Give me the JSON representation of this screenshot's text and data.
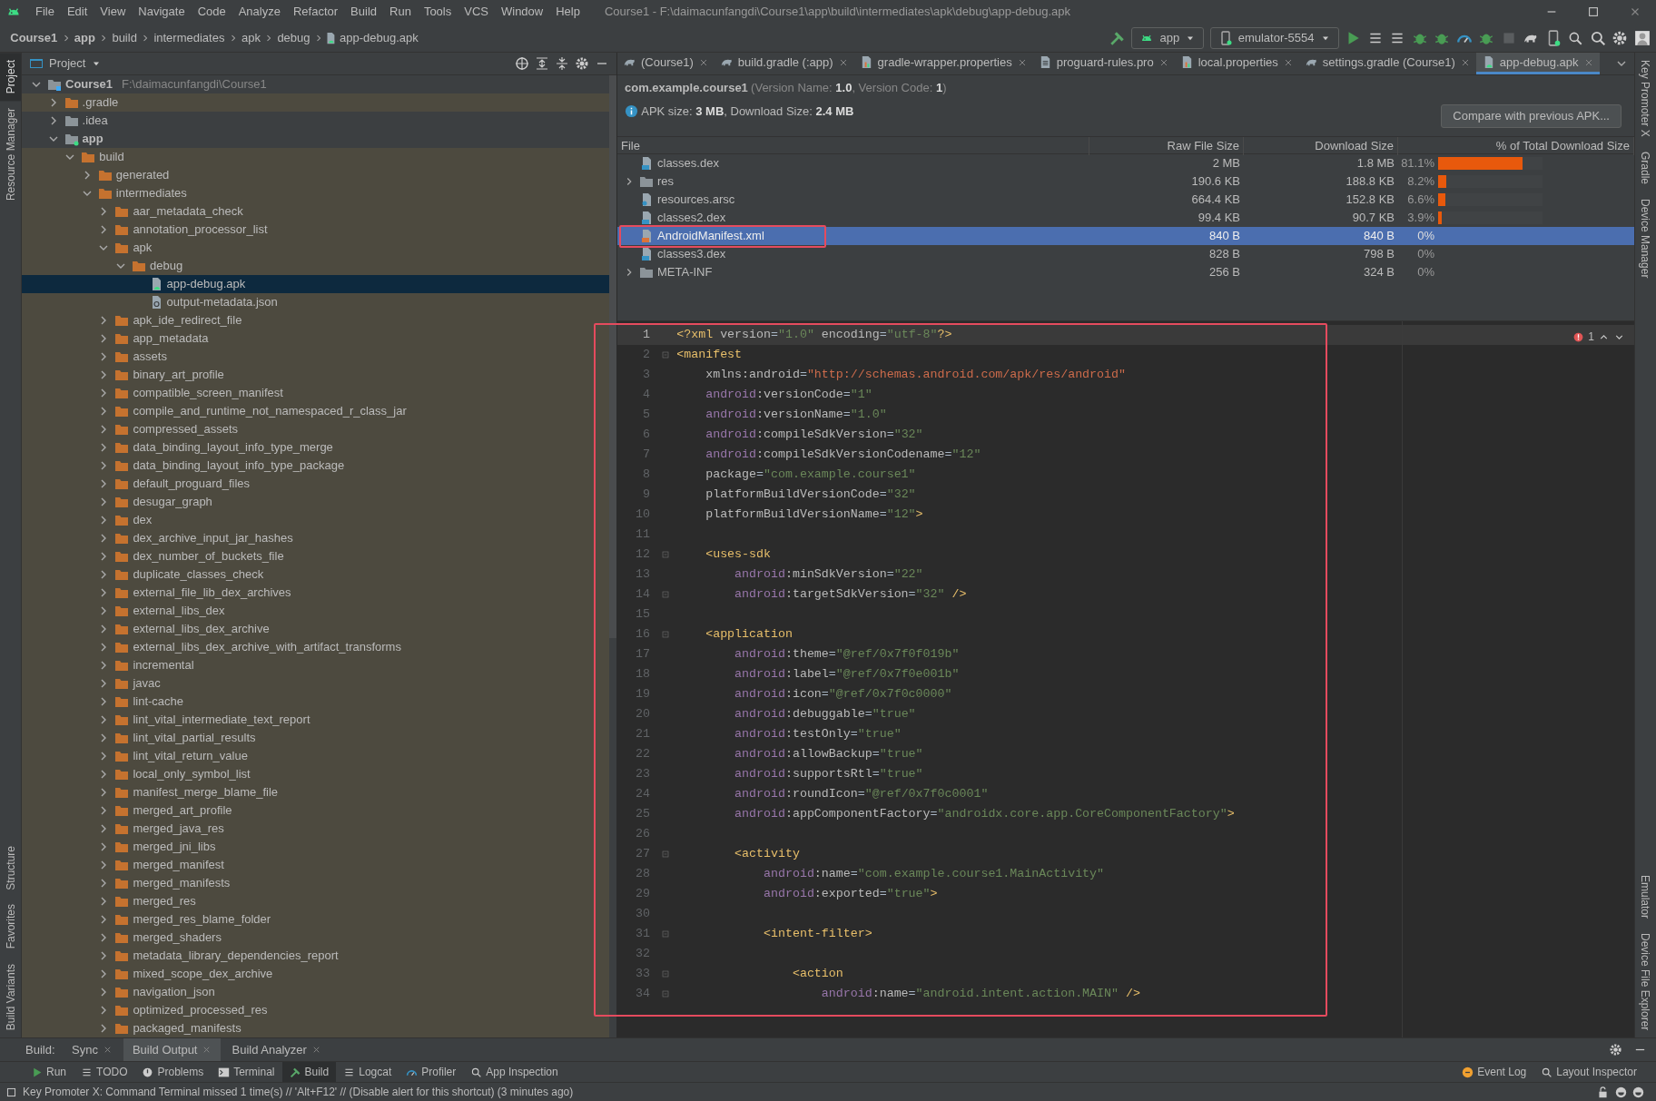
{
  "window": {
    "title": "Course1 - F:\\daimacunfangdi\\Course1\\app\\build\\intermediates\\apk\\debug\\app-debug.apk"
  },
  "menu": [
    "File",
    "Edit",
    "View",
    "Navigate",
    "Code",
    "Analyze",
    "Refactor",
    "Build",
    "Run",
    "Tools",
    "VCS",
    "Window",
    "Help"
  ],
  "breadcrumbs": [
    {
      "label": "Course1",
      "kind": "module"
    },
    {
      "label": "app",
      "kind": "module"
    },
    {
      "label": "build",
      "kind": "dir"
    },
    {
      "label": "intermediates",
      "kind": "dir"
    },
    {
      "label": "apk",
      "kind": "dir"
    },
    {
      "label": "debug",
      "kind": "dir"
    },
    {
      "label": "app-debug.apk",
      "kind": "file"
    }
  ],
  "run_config": "app",
  "device": "emulator-5554",
  "left_strip": {
    "top": [
      {
        "label": "Project",
        "selected": true
      },
      {
        "label": "Resource Manager",
        "selected": false
      }
    ],
    "bottom": [
      {
        "label": "Structure",
        "selected": false
      },
      {
        "label": "Favorites",
        "selected": false
      },
      {
        "label": "Build Variants",
        "selected": false
      }
    ]
  },
  "right_strip": {
    "top": [
      {
        "label": "Key Promoter X"
      },
      {
        "label": "Gradle"
      },
      {
        "label": "Device Manager"
      }
    ],
    "bottom": [
      {
        "label": "Emulator"
      },
      {
        "label": "Device File Explorer"
      }
    ]
  },
  "project_panel": {
    "title": "Project",
    "tree": [
      {
        "label": "Course1",
        "path": "F:\\daimacunfangdi\\Course1",
        "kind": "project",
        "expanded": true,
        "selected": false,
        "excluded": false,
        "children": [
          {
            "label": ".gradle",
            "kind": "folder",
            "expanded": false,
            "selected": false,
            "excluded": true
          },
          {
            "label": ".idea",
            "kind": "folder",
            "expanded": false,
            "selected": false,
            "excluded": false
          },
          {
            "label": "app",
            "kind": "module",
            "expanded": true,
            "selected": false,
            "excluded": false,
            "children": [
              {
                "label": "build",
                "kind": "folder",
                "expanded": true,
                "selected": false,
                "excluded": true,
                "children": [
                  {
                    "label": "generated",
                    "kind": "folder",
                    "expanded": false,
                    "selected": false,
                    "excluded": true
                  },
                  {
                    "label": "intermediates",
                    "kind": "folder",
                    "expanded": true,
                    "selected": false,
                    "excluded": true,
                    "children": [
                      {
                        "label": "aar_metadata_check",
                        "kind": "folder",
                        "expanded": false,
                        "selected": false,
                        "excluded": true
                      },
                      {
                        "label": "annotation_processor_list",
                        "kind": "folder",
                        "expanded": false,
                        "selected": false,
                        "excluded": true
                      },
                      {
                        "label": "apk",
                        "kind": "folder",
                        "expanded": true,
                        "selected": false,
                        "excluded": true,
                        "children": [
                          {
                            "label": "debug",
                            "kind": "folder",
                            "expanded": true,
                            "selected": false,
                            "excluded": true,
                            "children": [
                              {
                                "label": "app-debug.apk",
                                "kind": "apk",
                                "selected": true
                              },
                              {
                                "label": "output-metadata.json",
                                "kind": "json",
                                "selected": false,
                                "excluded": true
                              }
                            ]
                          }
                        ]
                      },
                      {
                        "label": "apk_ide_redirect_file",
                        "kind": "folder",
                        "expanded": false,
                        "selected": false,
                        "excluded": true
                      },
                      {
                        "label": "app_metadata",
                        "kind": "folder",
                        "expanded": false,
                        "selected": false,
                        "excluded": true
                      },
                      {
                        "label": "assets",
                        "kind": "folder",
                        "expanded": false,
                        "selected": false,
                        "excluded": true
                      },
                      {
                        "label": "binary_art_profile",
                        "kind": "folder",
                        "expanded": false,
                        "selected": false,
                        "excluded": true
                      },
                      {
                        "label": "compatible_screen_manifest",
                        "kind": "folder",
                        "expanded": false,
                        "selected": false,
                        "excluded": true
                      },
                      {
                        "label": "compile_and_runtime_not_namespaced_r_class_jar",
                        "kind": "folder",
                        "expanded": false,
                        "selected": false,
                        "excluded": true
                      },
                      {
                        "label": "compressed_assets",
                        "kind": "folder",
                        "expanded": false,
                        "selected": false,
                        "excluded": true
                      },
                      {
                        "label": "data_binding_layout_info_type_merge",
                        "kind": "folder",
                        "expanded": false,
                        "selected": false,
                        "excluded": true
                      },
                      {
                        "label": "data_binding_layout_info_type_package",
                        "kind": "folder",
                        "expanded": false,
                        "selected": false,
                        "excluded": true
                      },
                      {
                        "label": "default_proguard_files",
                        "kind": "folder",
                        "expanded": false,
                        "selected": false,
                        "excluded": true
                      },
                      {
                        "label": "desugar_graph",
                        "kind": "folder",
                        "expanded": false,
                        "selected": false,
                        "excluded": true
                      },
                      {
                        "label": "dex",
                        "kind": "folder",
                        "expanded": false,
                        "selected": false,
                        "excluded": true
                      },
                      {
                        "label": "dex_archive_input_jar_hashes",
                        "kind": "folder",
                        "expanded": false,
                        "selected": false,
                        "excluded": true
                      },
                      {
                        "label": "dex_number_of_buckets_file",
                        "kind": "folder",
                        "expanded": false,
                        "selected": false,
                        "excluded": true
                      },
                      {
                        "label": "duplicate_classes_check",
                        "kind": "folder",
                        "expanded": false,
                        "selected": false,
                        "excluded": true
                      },
                      {
                        "label": "external_file_lib_dex_archives",
                        "kind": "folder",
                        "expanded": false,
                        "selected": false,
                        "excluded": true
                      },
                      {
                        "label": "external_libs_dex",
                        "kind": "folder",
                        "expanded": false,
                        "selected": false,
                        "excluded": true
                      },
                      {
                        "label": "external_libs_dex_archive",
                        "kind": "folder",
                        "expanded": false,
                        "selected": false,
                        "excluded": true
                      },
                      {
                        "label": "external_libs_dex_archive_with_artifact_transforms",
                        "kind": "folder",
                        "expanded": false,
                        "selected": false,
                        "excluded": true
                      },
                      {
                        "label": "incremental",
                        "kind": "folder",
                        "expanded": false,
                        "selected": false,
                        "excluded": true
                      },
                      {
                        "label": "javac",
                        "kind": "folder",
                        "expanded": false,
                        "selected": false,
                        "excluded": true
                      },
                      {
                        "label": "lint-cache",
                        "kind": "folder",
                        "expanded": false,
                        "selected": false,
                        "excluded": true
                      },
                      {
                        "label": "lint_vital_intermediate_text_report",
                        "kind": "folder",
                        "expanded": false,
                        "selected": false,
                        "excluded": true
                      },
                      {
                        "label": "lint_vital_partial_results",
                        "kind": "folder",
                        "expanded": false,
                        "selected": false,
                        "excluded": true
                      },
                      {
                        "label": "lint_vital_return_value",
                        "kind": "folder",
                        "expanded": false,
                        "selected": false,
                        "excluded": true
                      },
                      {
                        "label": "local_only_symbol_list",
                        "kind": "folder",
                        "expanded": false,
                        "selected": false,
                        "excluded": true
                      },
                      {
                        "label": "manifest_merge_blame_file",
                        "kind": "folder",
                        "expanded": false,
                        "selected": false,
                        "excluded": true
                      },
                      {
                        "label": "merged_art_profile",
                        "kind": "folder",
                        "expanded": false,
                        "selected": false,
                        "excluded": true
                      },
                      {
                        "label": "merged_java_res",
                        "kind": "folder",
                        "expanded": false,
                        "selected": false,
                        "excluded": true
                      },
                      {
                        "label": "merged_jni_libs",
                        "kind": "folder",
                        "expanded": false,
                        "selected": false,
                        "excluded": true
                      },
                      {
                        "label": "merged_manifest",
                        "kind": "folder",
                        "expanded": false,
                        "selected": false,
                        "excluded": true
                      },
                      {
                        "label": "merged_manifests",
                        "kind": "folder",
                        "expanded": false,
                        "selected": false,
                        "excluded": true
                      },
                      {
                        "label": "merged_res",
                        "kind": "folder",
                        "expanded": false,
                        "selected": false,
                        "excluded": true
                      },
                      {
                        "label": "merged_res_blame_folder",
                        "kind": "folder",
                        "expanded": false,
                        "selected": false,
                        "excluded": true
                      },
                      {
                        "label": "merged_shaders",
                        "kind": "folder",
                        "expanded": false,
                        "selected": false,
                        "excluded": true
                      },
                      {
                        "label": "metadata_library_dependencies_report",
                        "kind": "folder",
                        "expanded": false,
                        "selected": false,
                        "excluded": true
                      },
                      {
                        "label": "mixed_scope_dex_archive",
                        "kind": "folder",
                        "expanded": false,
                        "selected": false,
                        "excluded": true
                      },
                      {
                        "label": "navigation_json",
                        "kind": "folder",
                        "expanded": false,
                        "selected": false,
                        "excluded": true
                      },
                      {
                        "label": "optimized_processed_res",
                        "kind": "folder",
                        "expanded": false,
                        "selected": false,
                        "excluded": true
                      },
                      {
                        "label": "packaged_manifests",
                        "kind": "folder",
                        "expanded": false,
                        "selected": false,
                        "excluded": true
                      }
                    ]
                  }
                ]
              }
            ]
          }
        ]
      }
    ]
  },
  "editor_tabs": [
    {
      "label": "(Course1)",
      "kind": "gradle",
      "selected": false
    },
    {
      "label": "build.gradle (:app)",
      "kind": "gradle",
      "selected": false
    },
    {
      "label": "gradle-wrapper.properties",
      "kind": "properties",
      "selected": false
    },
    {
      "label": "proguard-rules.pro",
      "kind": "text",
      "selected": false
    },
    {
      "label": "local.properties",
      "kind": "properties",
      "selected": false
    },
    {
      "label": "settings.gradle (Course1)",
      "kind": "gradle",
      "selected": false
    },
    {
      "label": "app-debug.apk",
      "kind": "apk",
      "selected": true
    }
  ],
  "apk": {
    "package": "com.example.course1",
    "version": "(Version Name: **1.0**, Version Code: **1**)",
    "summary": "APK size: **3 MB**, Download Size: **2.4 MB**",
    "compare_button": "Compare with previous APK...",
    "columns": [
      "File",
      "Raw File Size",
      "Download Size",
      "% of Total Download Size"
    ],
    "rows": [
      {
        "name": "classes.dex",
        "kind": "dex",
        "expandable": false,
        "raw": "2 MB",
        "download": "1.8 MB",
        "percent": "81.1%",
        "level": 0.811,
        "selected": false,
        "outlined": false
      },
      {
        "name": "res",
        "kind": "folder",
        "expandable": true,
        "raw": "190.6 KB",
        "download": "188.8 KB",
        "percent": "8.2%",
        "level": 0.082,
        "selected": false,
        "outlined": false
      },
      {
        "name": "resources.arsc",
        "kind": "arsc",
        "expandable": false,
        "raw": "664.4 KB",
        "download": "152.8 KB",
        "percent": "6.6%",
        "level": 0.066,
        "selected": false,
        "outlined": false
      },
      {
        "name": "classes2.dex",
        "kind": "dex",
        "expandable": false,
        "raw": "99.4 KB",
        "download": "90.7 KB",
        "percent": "3.9%",
        "level": 0.039,
        "selected": false,
        "outlined": false
      },
      {
        "name": "AndroidManifest.xml",
        "kind": "xml",
        "expandable": false,
        "raw": "840 B",
        "download": "840 B",
        "percent": "0%",
        "selected": true,
        "outlined": true
      },
      {
        "name": "classes3.dex",
        "kind": "dex",
        "expandable": false,
        "raw": "828 B",
        "download": "798 B",
        "percent": "0%",
        "selected": false,
        "outlined": false
      },
      {
        "name": "META-INF",
        "kind": "folder",
        "expandable": true,
        "raw": "256 B",
        "download": "324 B",
        "percent": "0%",
        "selected": false,
        "outlined": false
      }
    ]
  },
  "code": {
    "outlined": true,
    "problems": "1",
    "lines": [
      {
        "n": "1",
        "fold": false,
        "current": true,
        "seg": [
          {
            "tag": "<?xml "
          },
          {
            "attr": "version"
          },
          {
            "plain": "="
          },
          {
            "val": "\"1.0\""
          },
          {
            "attr": " encoding"
          },
          {
            "plain": "="
          },
          {
            "val": "\"utf-8\""
          },
          {
            "tag": "?>"
          }
        ]
      },
      {
        "n": "2",
        "fold": true,
        "current": false,
        "seg": [
          {
            "tag": "<manifest"
          }
        ]
      },
      {
        "n": "3",
        "fold": false,
        "current": false,
        "seg": [
          {
            "attr": "    xmlns:android"
          },
          {
            "plain": "="
          },
          {
            "url": "\"http://schemas.android.com/apk/res/android\""
          }
        ]
      },
      {
        "n": "4",
        "fold": false,
        "current": false,
        "seg": [
          {
            "ns": "    android"
          },
          {
            "attr": ":versionCode"
          },
          {
            "plain": "="
          },
          {
            "val": "\"1\""
          }
        ]
      },
      {
        "n": "5",
        "fold": false,
        "current": false,
        "seg": [
          {
            "ns": "    android"
          },
          {
            "attr": ":versionName"
          },
          {
            "plain": "="
          },
          {
            "val": "\"1.0\""
          }
        ]
      },
      {
        "n": "6",
        "fold": false,
        "current": false,
        "seg": [
          {
            "ns": "    android"
          },
          {
            "attr": ":compileSdkVersion"
          },
          {
            "plain": "="
          },
          {
            "val": "\"32\""
          }
        ]
      },
      {
        "n": "7",
        "fold": false,
        "current": false,
        "seg": [
          {
            "ns": "    android"
          },
          {
            "attr": ":compileSdkVersionCodename"
          },
          {
            "plain": "="
          },
          {
            "val": "\"12\""
          }
        ]
      },
      {
        "n": "8",
        "fold": false,
        "current": false,
        "seg": [
          {
            "attr": "    package"
          },
          {
            "plain": "="
          },
          {
            "val": "\"com.example.course1\""
          }
        ]
      },
      {
        "n": "9",
        "fold": false,
        "current": false,
        "seg": [
          {
            "attr": "    platformBuildVersionCode"
          },
          {
            "plain": "="
          },
          {
            "val": "\"32\""
          }
        ]
      },
      {
        "n": "10",
        "fold": false,
        "current": false,
        "seg": [
          {
            "attr": "    platformBuildVersionName"
          },
          {
            "plain": "="
          },
          {
            "val": "\"12\""
          },
          {
            "tag": ">"
          }
        ]
      },
      {
        "n": "11",
        "fold": false,
        "current": false
      },
      {
        "n": "12",
        "fold": true,
        "current": false,
        "seg": [
          {
            "tag": "    <uses-sdk"
          }
        ]
      },
      {
        "n": "13",
        "fold": false,
        "current": false,
        "seg": [
          {
            "ns": "        android"
          },
          {
            "attr": ":minSdkVersion"
          },
          {
            "plain": "="
          },
          {
            "val": "\"22\""
          }
        ]
      },
      {
        "n": "14",
        "fold": true,
        "current": false,
        "seg": [
          {
            "ns": "        android"
          },
          {
            "attr": ":targetSdkVersion"
          },
          {
            "plain": "="
          },
          {
            "val": "\"32\""
          },
          {
            "tag": " />"
          }
        ]
      },
      {
        "n": "15",
        "fold": false,
        "current": false
      },
      {
        "n": "16",
        "fold": true,
        "current": false,
        "seg": [
          {
            "tag": "    <application"
          }
        ]
      },
      {
        "n": "17",
        "fold": false,
        "current": false,
        "seg": [
          {
            "ns": "        android"
          },
          {
            "attr": ":theme"
          },
          {
            "plain": "="
          },
          {
            "val": "\"@ref/0x7f0f019b\""
          }
        ]
      },
      {
        "n": "18",
        "fold": false,
        "current": false,
        "seg": [
          {
            "ns": "        android"
          },
          {
            "attr": ":label"
          },
          {
            "plain": "="
          },
          {
            "val": "\"@ref/0x7f0e001b\""
          }
        ]
      },
      {
        "n": "19",
        "fold": false,
        "current": false,
        "seg": [
          {
            "ns": "        android"
          },
          {
            "attr": ":icon"
          },
          {
            "plain": "="
          },
          {
            "val": "\"@ref/0x7f0c0000\""
          }
        ]
      },
      {
        "n": "20",
        "fold": false,
        "current": false,
        "seg": [
          {
            "ns": "        android"
          },
          {
            "attr": ":debuggable"
          },
          {
            "plain": "="
          },
          {
            "val": "\"true\""
          }
        ]
      },
      {
        "n": "21",
        "fold": false,
        "current": false,
        "seg": [
          {
            "ns": "        android"
          },
          {
            "attr": ":testOnly"
          },
          {
            "plain": "="
          },
          {
            "val": "\"true\""
          }
        ]
      },
      {
        "n": "22",
        "fold": false,
        "current": false,
        "seg": [
          {
            "ns": "        android"
          },
          {
            "attr": ":allowBackup"
          },
          {
            "plain": "="
          },
          {
            "val": "\"true\""
          }
        ]
      },
      {
        "n": "23",
        "fold": false,
        "current": false,
        "seg": [
          {
            "ns": "        android"
          },
          {
            "attr": ":supportsRtl"
          },
          {
            "plain": "="
          },
          {
            "val": "\"true\""
          }
        ]
      },
      {
        "n": "24",
        "fold": false,
        "current": false,
        "seg": [
          {
            "ns": "        android"
          },
          {
            "attr": ":roundIcon"
          },
          {
            "plain": "="
          },
          {
            "val": "\"@ref/0x7f0c0001\""
          }
        ]
      },
      {
        "n": "25",
        "fold": false,
        "current": false,
        "seg": [
          {
            "ns": "        android"
          },
          {
            "attr": ":appComponentFactory"
          },
          {
            "plain": "="
          },
          {
            "val": "\"androidx.core.app.CoreComponentFactory\""
          },
          {
            "tag": ">"
          }
        ]
      },
      {
        "n": "26",
        "fold": false,
        "current": false
      },
      {
        "n": "27",
        "fold": true,
        "current": false,
        "seg": [
          {
            "tag": "        <activity"
          }
        ]
      },
      {
        "n": "28",
        "fold": false,
        "current": false,
        "seg": [
          {
            "ns": "            android"
          },
          {
            "attr": ":name"
          },
          {
            "plain": "="
          },
          {
            "val": "\"com.example.course1.MainActivity\""
          }
        ]
      },
      {
        "n": "29",
        "fold": false,
        "current": false,
        "seg": [
          {
            "ns": "            android"
          },
          {
            "attr": ":exported"
          },
          {
            "plain": "="
          },
          {
            "val": "\"true\""
          },
          {
            "tag": ">"
          }
        ]
      },
      {
        "n": "30",
        "fold": false,
        "current": false
      },
      {
        "n": "31",
        "fold": true,
        "current": false,
        "seg": [
          {
            "tag": "            <intent-filter>"
          }
        ]
      },
      {
        "n": "32",
        "fold": false,
        "current": false
      },
      {
        "n": "33",
        "fold": true,
        "current": false,
        "seg": [
          {
            "tag": "                <action"
          }
        ]
      },
      {
        "n": "34",
        "fold": true,
        "current": false,
        "seg": [
          {
            "ns": "                    android"
          },
          {
            "attr": ":name"
          },
          {
            "plain": "="
          },
          {
            "val": "\"android.intent.action.MAIN\""
          },
          {
            "tag": " />"
          }
        ]
      }
    ]
  },
  "build_tabs": {
    "label": "Build:",
    "tabs": [
      {
        "label": "Sync",
        "selected": false
      },
      {
        "label": "Build Output",
        "selected": true
      },
      {
        "label": "Build Analyzer",
        "selected": false
      }
    ]
  },
  "tool_windows": {
    "left": [
      {
        "label": "Run",
        "kind": "run",
        "selected": false
      },
      {
        "label": "TODO",
        "kind": "list",
        "selected": false
      },
      {
        "label": "Problems",
        "kind": "problems",
        "selected": false
      },
      {
        "label": "Terminal",
        "kind": "terminal",
        "selected": false
      },
      {
        "label": "Build",
        "kind": "hammer",
        "selected": true
      },
      {
        "label": "Logcat",
        "kind": "list",
        "selected": false
      },
      {
        "label": "Profiler",
        "kind": "gauge",
        "selected": false
      },
      {
        "label": "App Inspection",
        "kind": "inspect",
        "selected": false
      }
    ],
    "right": [
      {
        "label": "Event Log",
        "kind": "log",
        "selected": false
      },
      {
        "label": "Layout Inspector",
        "kind": "inspect",
        "selected": false
      }
    ]
  },
  "status_bar": {
    "message": "Key Promoter X: Command Terminal missed 1 time(s) // 'Alt+F12' // (Disable alert for this shortcut) (3 minutes ago)"
  }
}
